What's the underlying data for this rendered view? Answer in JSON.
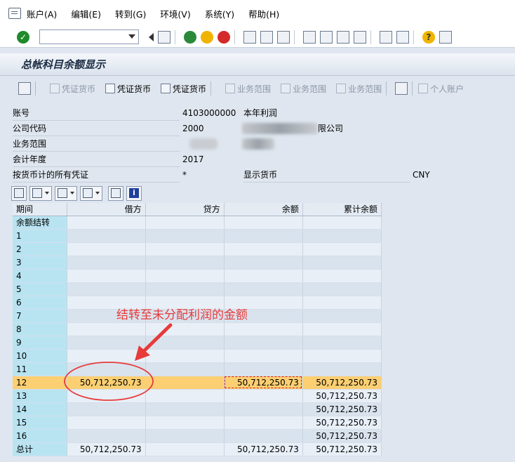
{
  "menu": [
    "账户(A)",
    "编辑(E)",
    "转到(G)",
    "环境(V)",
    "系统(Y)",
    "帮助(H)"
  ],
  "command_field": {
    "value": ""
  },
  "title": "总帐科目余额显示",
  "app_toolbar": [
    {
      "label": "凭证货币",
      "enabled": false
    },
    {
      "label": "凭证货币",
      "enabled": true
    },
    {
      "label": "凭证货币",
      "enabled": true
    },
    {
      "label": "业务范围",
      "enabled": false
    },
    {
      "label": "业务范围",
      "enabled": false
    },
    {
      "label": "业务范围",
      "enabled": false
    },
    {
      "label": "个人账户",
      "enabled": false
    }
  ],
  "form": {
    "account_label": "账号",
    "account_value": "4103000000",
    "account_desc": "本年利润",
    "company_label": "公司代码",
    "company_value": "2000",
    "company_desc": "限公司",
    "business_area_label": "业务范围",
    "fiscal_year_label": "会计年度",
    "fiscal_year_value": "2017",
    "docs_label": "按货币计的所有凭证",
    "docs_value": "*",
    "currency_label": "显示货币",
    "currency_value": "CNY"
  },
  "table": {
    "headers": [
      "期间",
      "借方",
      "贷方",
      "余额",
      "累计余额"
    ],
    "rows": [
      {
        "period": "余额结转",
        "debit": "",
        "credit": "",
        "balance": "",
        "cum": ""
      },
      {
        "period": "1",
        "debit": "",
        "credit": "",
        "balance": "",
        "cum": ""
      },
      {
        "period": "2",
        "debit": "",
        "credit": "",
        "balance": "",
        "cum": ""
      },
      {
        "period": "3",
        "debit": "",
        "credit": "",
        "balance": "",
        "cum": ""
      },
      {
        "period": "4",
        "debit": "",
        "credit": "",
        "balance": "",
        "cum": ""
      },
      {
        "period": "5",
        "debit": "",
        "credit": "",
        "balance": "",
        "cum": ""
      },
      {
        "period": "6",
        "debit": "",
        "credit": "",
        "balance": "",
        "cum": ""
      },
      {
        "period": "7",
        "debit": "",
        "credit": "",
        "balance": "",
        "cum": ""
      },
      {
        "period": "8",
        "debit": "",
        "credit": "",
        "balance": "",
        "cum": ""
      },
      {
        "period": "9",
        "debit": "",
        "credit": "",
        "balance": "",
        "cum": ""
      },
      {
        "period": "10",
        "debit": "",
        "credit": "",
        "balance": "",
        "cum": ""
      },
      {
        "period": "11",
        "debit": "",
        "credit": "",
        "balance": "",
        "cum": ""
      },
      {
        "period": "12",
        "debit": "50,712,250.73",
        "credit": "",
        "balance": "50,712,250.73",
        "cum": "50,712,250.73"
      },
      {
        "period": "13",
        "debit": "",
        "credit": "",
        "balance": "",
        "cum": "50,712,250.73"
      },
      {
        "period": "14",
        "debit": "",
        "credit": "",
        "balance": "",
        "cum": "50,712,250.73"
      },
      {
        "period": "15",
        "debit": "",
        "credit": "",
        "balance": "",
        "cum": "50,712,250.73"
      },
      {
        "period": "16",
        "debit": "",
        "credit": "",
        "balance": "",
        "cum": "50,712,250.73"
      },
      {
        "period": "总计",
        "debit": "50,712,250.73",
        "credit": "",
        "balance": "50,712,250.73",
        "cum": "50,712,250.73"
      }
    ]
  },
  "annotation": "结转至未分配利润的金额",
  "colors": {
    "annotation": "#e83a3a",
    "highlight_row": "#fbcf72",
    "period_col": "#b8e4f2"
  }
}
